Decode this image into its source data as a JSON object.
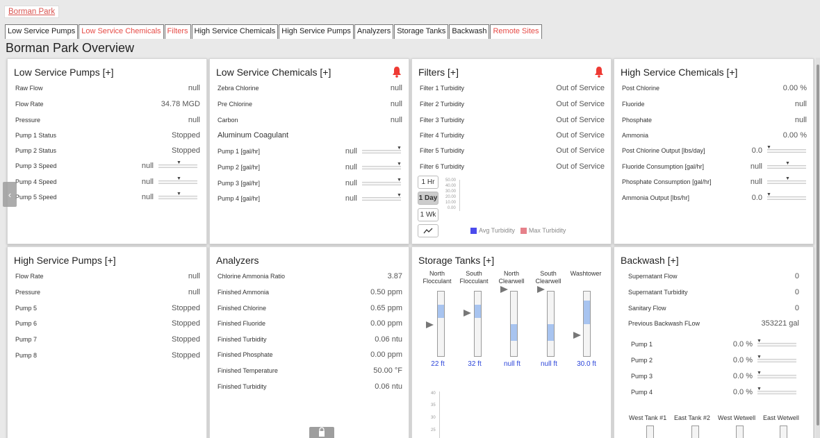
{
  "breadcrumb": "Borman Park",
  "tabs": [
    {
      "label": "Low Service Pumps",
      "red": false
    },
    {
      "label": "Low Service Chemicals",
      "red": true
    },
    {
      "label": "Filters",
      "red": true
    },
    {
      "label": "High Service Chemicals",
      "red": false
    },
    {
      "label": "High Service Pumps",
      "red": false
    },
    {
      "label": "Analyzers",
      "red": false
    },
    {
      "label": "Storage Tanks",
      "red": false
    },
    {
      "label": "Backwash",
      "red": false
    },
    {
      "label": "Remote Sites",
      "red": true
    }
  ],
  "page_title": "Borman Park Overview",
  "colors": {
    "alarm": "#ee3a34",
    "tab_alarm": "#e64a45",
    "tank_fill": "#a8c4f0",
    "tank_value": "#2b44d9",
    "avg_turbidity": "#4b4bec",
    "max_turbidity": "#e6818a"
  },
  "low_service_pumps": {
    "title": "Low Service Pumps [+]",
    "rows": [
      {
        "label": "Raw Flow",
        "value": "null"
      },
      {
        "label": "Flow Rate",
        "value": "34.78 MGD"
      },
      {
        "label": "Pressure",
        "value": "null"
      },
      {
        "label": "Pump 1 Status",
        "value": "Stopped"
      },
      {
        "label": "Pump 2 Status",
        "value": "Stopped"
      },
      {
        "label": "Pump 3 Speed",
        "value": "null",
        "slider": true
      },
      {
        "label": "Pump 4 Speed",
        "value": "null",
        "slider": true
      },
      {
        "label": "Pump 5 Speed",
        "value": "null",
        "slider": true
      }
    ]
  },
  "low_service_chemicals": {
    "title": "Low Service Chemicals [+]",
    "rows": [
      {
        "label": "Zebra Chlorine",
        "value": "null"
      },
      {
        "label": "Pre Chlorine",
        "value": "null"
      },
      {
        "label": "Carbon",
        "value": "null"
      }
    ],
    "subheading": "Aluminum Coagulant",
    "pumps": [
      {
        "label": "Pump 1 [gal/hr]",
        "value": "null"
      },
      {
        "label": "Pump 2 [gal/hr]",
        "value": "null"
      },
      {
        "label": "Pump 3 [gal/hr]",
        "value": "null"
      },
      {
        "label": "Pump 4 [gal/hr]",
        "value": "null"
      }
    ]
  },
  "filters": {
    "title": "Filters [+]",
    "rows": [
      {
        "label": "Filter 1 Turbidity",
        "value": "Out of Service"
      },
      {
        "label": "Filter 2 Turbidity",
        "value": "Out of Service"
      },
      {
        "label": "Filter 3 Turbidity",
        "value": "Out of Service"
      },
      {
        "label": "Filter 4 Turbidity",
        "value": "Out of Service"
      },
      {
        "label": "Filter 5 Turbidity",
        "value": "Out of Service"
      },
      {
        "label": "Filter 6 Turbidity",
        "value": "Out of Service"
      }
    ],
    "ranges": [
      "1 Hr",
      "1 Day",
      "1 Wk"
    ],
    "active_range": "1 Day",
    "y_ticks": [
      "50.00",
      "40.00",
      "30.00",
      "20.00",
      "10.00",
      "0.00"
    ],
    "legend": [
      "Avg Turbidity",
      "Max Turbidity"
    ]
  },
  "high_service_chemicals": {
    "title": "High Service Chemicals [+]",
    "rows": [
      {
        "label": "Post Chlorine",
        "value": "0.00 %"
      },
      {
        "label": "Fluoride",
        "value": "null"
      },
      {
        "label": "Phosphate",
        "value": "null"
      },
      {
        "label": "Ammonia",
        "value": "0.00 %"
      },
      {
        "label": "Post Chlorine Output [lbs/day]",
        "value": "0.0",
        "slider": true
      },
      {
        "label": "Fluoride Consumption [gal/hr]",
        "value": "null",
        "slider": true
      },
      {
        "label": "Phosphate Consumption [gal/hr]",
        "value": "null",
        "slider": true
      },
      {
        "label": "Ammonia Output [lbs/hr]",
        "value": "0.0",
        "slider": true
      }
    ]
  },
  "high_service_pumps": {
    "title": "High Service Pumps [+]",
    "rows": [
      {
        "label": "Flow Rate",
        "value": "null"
      },
      {
        "label": "Pressure",
        "value": "null"
      },
      {
        "label": "Pump 5",
        "value": "Stopped"
      },
      {
        "label": "Pump 6",
        "value": "Stopped"
      },
      {
        "label": "Pump 7",
        "value": "Stopped"
      },
      {
        "label": "Pump 8",
        "value": "Stopped"
      }
    ]
  },
  "analyzers": {
    "title": "Analyzers",
    "rows": [
      {
        "label": "Chlorine Ammonia Ratio",
        "value": "3.87"
      },
      {
        "label": "Finished Ammonia",
        "value": "0.50 ppm"
      },
      {
        "label": "Finished Chlorine",
        "value": "0.65 ppm"
      },
      {
        "label": "Finished Fluoride",
        "value": "0.00 ppm"
      },
      {
        "label": "Finished Turbidity",
        "value": "0.06 ntu"
      },
      {
        "label": "Finished Phosphate",
        "value": "0.00 ppm"
      },
      {
        "label": "Finished Temperature",
        "value": "50.00 °F"
      },
      {
        "label": "Finished Turbidity",
        "value": "0.06 ntu"
      }
    ]
  },
  "storage_tanks": {
    "title": "Storage Tanks [+]",
    "tanks": [
      {
        "name1": "North",
        "name2": "Flocculant",
        "value": "22 ft",
        "fill_top": 0.2,
        "fill_height": 0.2,
        "arrow": 0.55
      },
      {
        "name1": "South",
        "name2": "Flocculant",
        "value": "32 ft",
        "fill_top": 0.2,
        "fill_height": 0.2,
        "arrow": 0.35
      },
      {
        "name1": "North",
        "name2": "Clearwell",
        "value": "null ft",
        "fill_top": 0.5,
        "fill_height": 0.25,
        "arrow": 0.0
      },
      {
        "name1": "South",
        "name2": "Clearwell",
        "value": "null ft",
        "fill_top": 0.5,
        "fill_height": 0.25,
        "arrow": 0.0
      },
      {
        "name1": "",
        "name2": "Washtower",
        "value": "30.0 ft",
        "fill_top": 0.15,
        "fill_height": 0.35,
        "arrow": 0.65
      }
    ],
    "y_ticks": [
      "40",
      "35",
      "30",
      "25"
    ]
  },
  "backwash": {
    "title": "Backwash [+]",
    "rows": [
      {
        "label": "Supernatant Flow",
        "value": "0"
      },
      {
        "label": "Supernatant Turbidity",
        "value": "0"
      },
      {
        "label": "Sanitary Flow",
        "value": "0"
      },
      {
        "label": "Previous Backwash FLow",
        "value": "353221 gal"
      }
    ],
    "pumps": [
      {
        "label": "Pump 1",
        "value": "0.0 %"
      },
      {
        "label": "Pump 2",
        "value": "0.0 %"
      },
      {
        "label": "Pump 3",
        "value": "0.0 %"
      },
      {
        "label": "Pump 4",
        "value": "0.0 %"
      }
    ],
    "wells": [
      "West Tank #1",
      "East Tank #2",
      "West Wetwell",
      "East Wetwell"
    ]
  }
}
